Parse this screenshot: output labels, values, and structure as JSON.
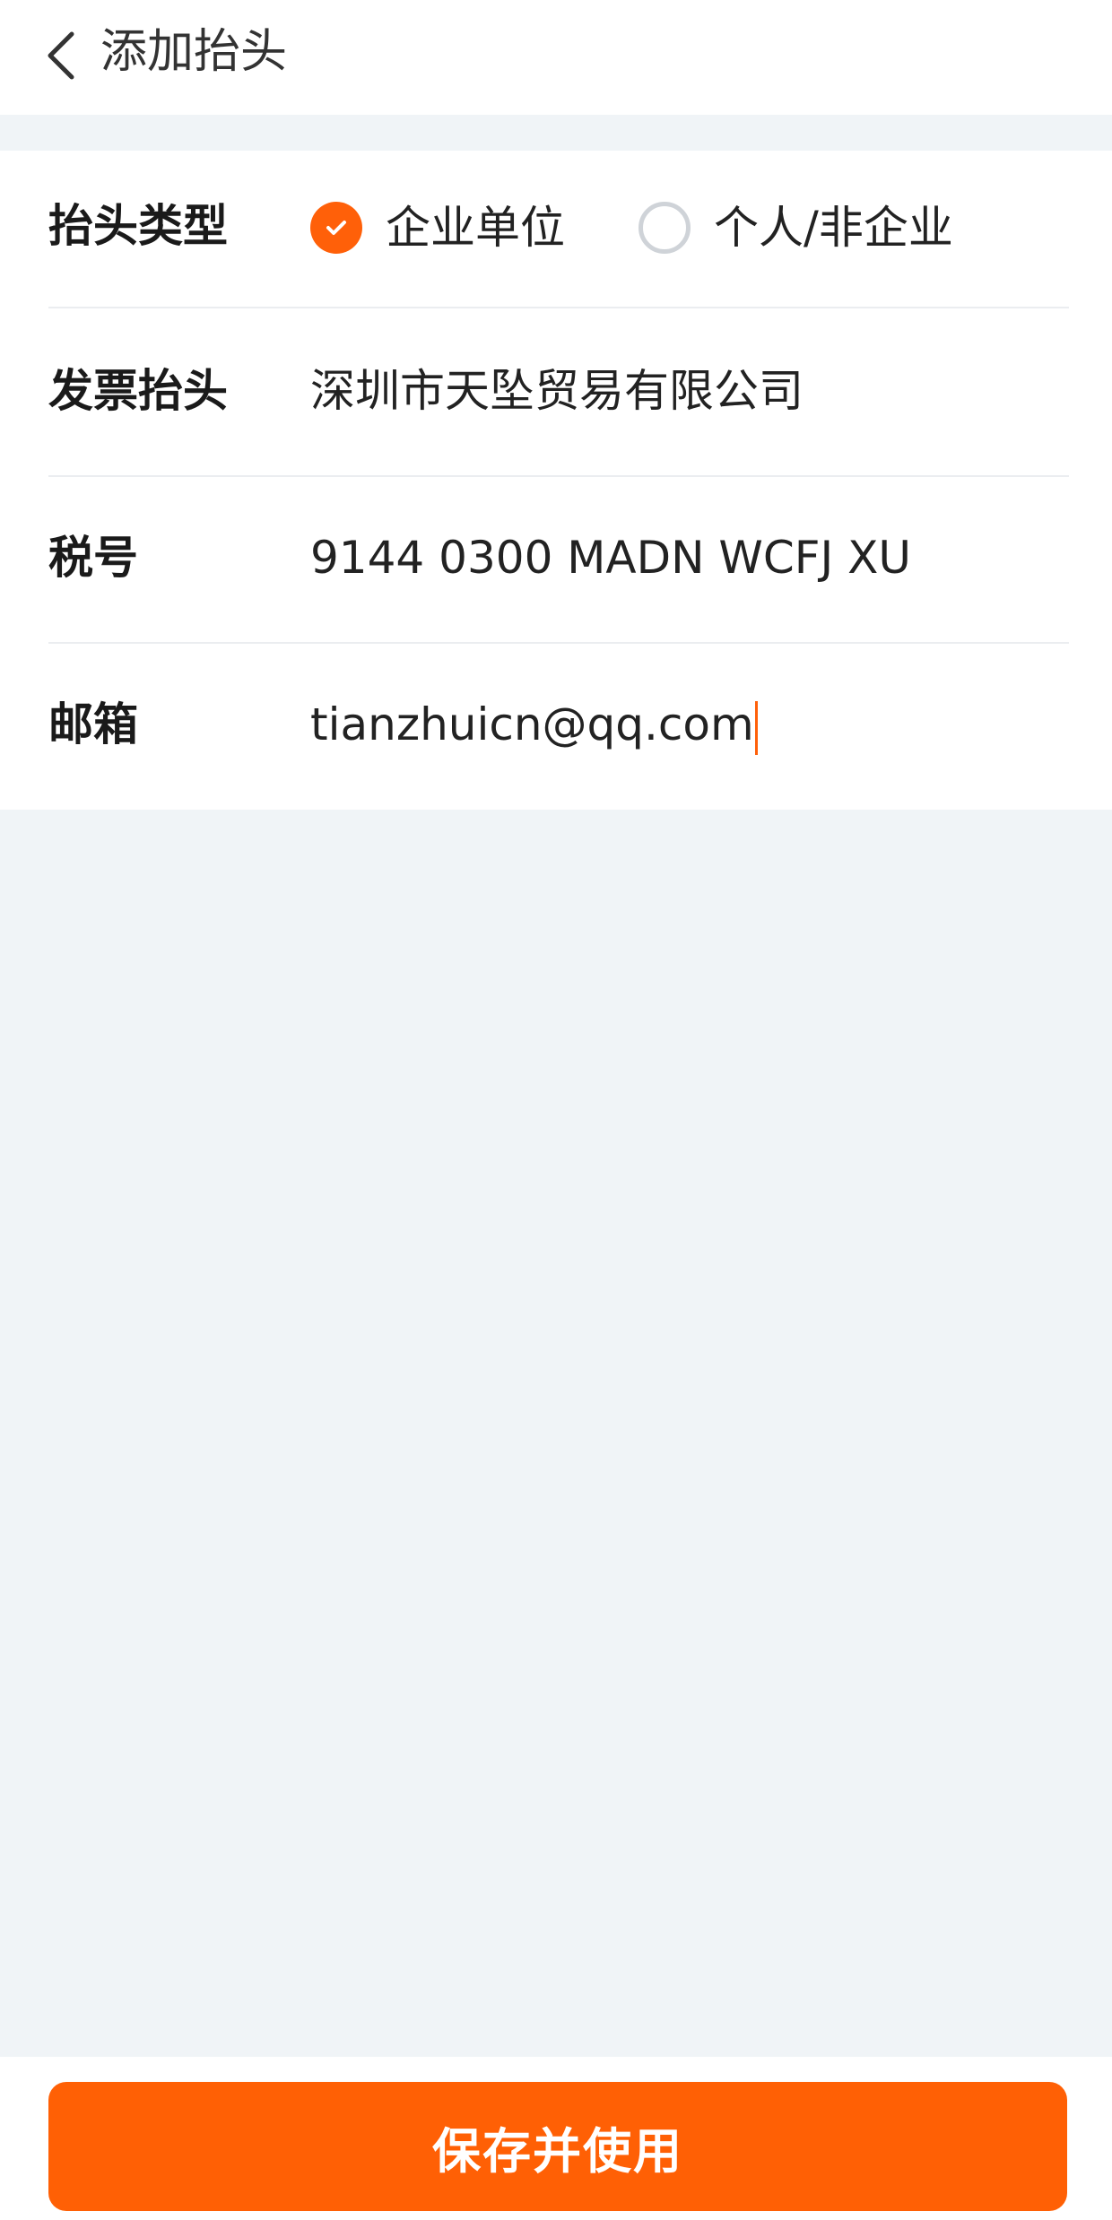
{
  "header": {
    "back_icon": "chevron-left-icon",
    "title": "添加抬头"
  },
  "form": {
    "title_type": {
      "label": "抬头类型",
      "options": [
        {
          "label": "企业单位",
          "checked": true
        },
        {
          "label": "个人/非企业",
          "checked": false
        }
      ]
    },
    "invoice_title": {
      "label": "发票抬头",
      "value": "深圳市天坠贸易有限公司"
    },
    "tax_number": {
      "label": "税号",
      "value": "9144 0300 MADN WCFJ XU"
    },
    "email": {
      "label": "邮箱",
      "value": "tianzhuicn@qq.com"
    }
  },
  "footer": {
    "save_label": "保存并使用"
  },
  "colors": {
    "accent": "#ff6009",
    "background": "#f0f4f7",
    "divider": "#ebedf0"
  }
}
